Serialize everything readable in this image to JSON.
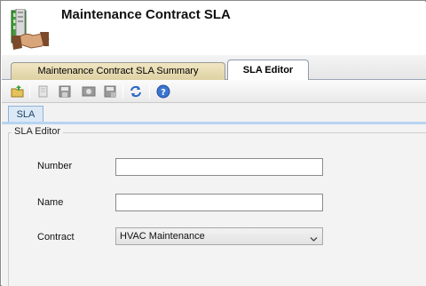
{
  "header": {
    "title": "Maintenance Contract SLA"
  },
  "tabs": [
    {
      "label": "Maintenance Contract SLA Summary",
      "active": false
    },
    {
      "label": "SLA Editor",
      "active": true
    }
  ],
  "toolbar": {
    "icons": [
      "add-icon",
      "copy-icon",
      "save-icon",
      "save-close-icon",
      "save-new-icon",
      "refresh-icon",
      "help-icon"
    ]
  },
  "inner_tab": {
    "label": "SLA"
  },
  "editor": {
    "group_label": "SLA Editor",
    "fields": {
      "number": {
        "label": "Number",
        "value": ""
      },
      "name": {
        "label": "Name",
        "value": ""
      },
      "contract": {
        "label": "Contract",
        "value": "HVAC Maintenance"
      }
    }
  },
  "colors": {
    "summary_tab": "#e6dbb0",
    "active_tab": "#ffffff",
    "inner_tab": "#dbe9f7",
    "panel_bg": "#f3f3f3"
  }
}
